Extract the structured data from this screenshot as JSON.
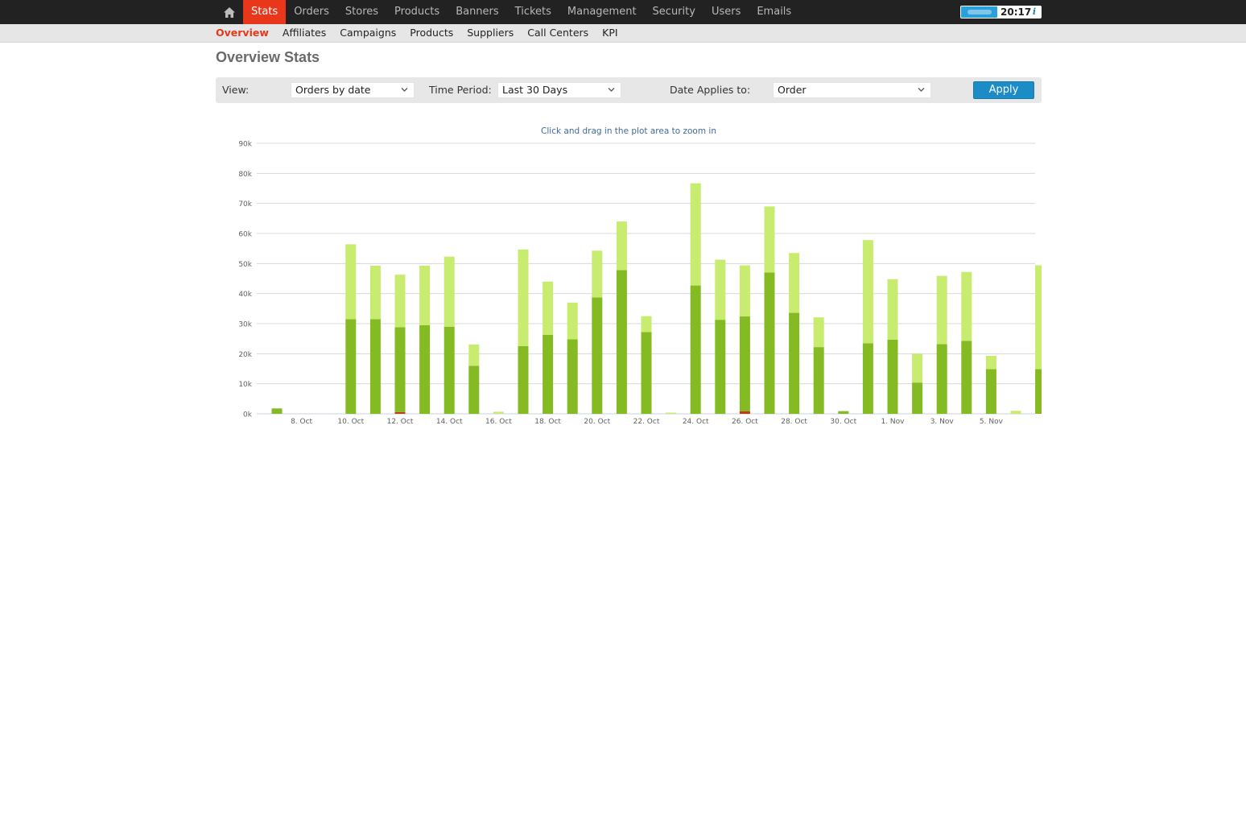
{
  "topnav": {
    "home_icon": "home-icon",
    "items": [
      {
        "label": "Stats",
        "active": true
      },
      {
        "label": "Orders"
      },
      {
        "label": "Stores"
      },
      {
        "label": "Products"
      },
      {
        "label": "Banners"
      },
      {
        "label": "Tickets"
      },
      {
        "label": "Management"
      },
      {
        "label": "Security"
      },
      {
        "label": "Users"
      },
      {
        "label": "Emails"
      }
    ],
    "clock": "20:17",
    "info_icon": "i"
  },
  "subnav": {
    "items": [
      {
        "label": "Overview",
        "active": true
      },
      {
        "label": "Affiliates"
      },
      {
        "label": "Campaigns"
      },
      {
        "label": "Products"
      },
      {
        "label": "Suppliers"
      },
      {
        "label": "Call Centers"
      },
      {
        "label": "KPI"
      }
    ]
  },
  "page": {
    "title": "Overview Stats"
  },
  "filters": {
    "view_label": "View:",
    "view_value": "Orders by date",
    "period_label": "Time Period:",
    "period_value": "Last 30 Days",
    "applies_label": "Date Applies to:",
    "applies_value": "Order",
    "apply_label": "Apply"
  },
  "colors": {
    "accent": "#e8371b",
    "nav_bg": "#222222",
    "button": "#1b8cc6",
    "bar_dark": "#84bb22",
    "bar_light": "#c8ec70",
    "bar_red": "#c0391b"
  },
  "chart_data": {
    "type": "bar",
    "stacked": true,
    "subtitle": "Click and drag in the plot area to zoom in",
    "ylim": [
      0,
      90000
    ],
    "y_ticks": [
      {
        "value": 0,
        "label": "0k"
      },
      {
        "value": 10000,
        "label": "10k"
      },
      {
        "value": 20000,
        "label": "20k"
      },
      {
        "value": 30000,
        "label": "30k"
      },
      {
        "value": 40000,
        "label": "40k"
      },
      {
        "value": 50000,
        "label": "50k"
      },
      {
        "value": 60000,
        "label": "60k"
      },
      {
        "value": 70000,
        "label": "70k"
      },
      {
        "value": 80000,
        "label": "80k"
      },
      {
        "value": 90000,
        "label": "90k"
      }
    ],
    "x_ticks": [
      "8. Oct",
      "10. Oct",
      "12. Oct",
      "14. Oct",
      "16. Oct",
      "18. Oct",
      "20. Oct",
      "22. Oct",
      "24. Oct",
      "26. Oct",
      "28. Oct",
      "30. Oct",
      "1. Nov",
      "3. Nov",
      "5. Nov"
    ],
    "grid": true,
    "legend": "none",
    "series": [
      {
        "color": "#c0391b",
        "values": [
          0,
          0,
          0,
          0,
          0,
          600,
          0,
          0,
          0,
          0,
          0,
          0,
          0,
          0,
          0,
          0,
          0,
          0,
          0,
          800,
          0,
          0,
          0,
          0,
          0,
          0,
          0,
          0,
          0,
          0,
          0,
          0
        ]
      },
      {
        "color": "#84bb22",
        "values": [
          1800,
          0,
          0,
          31500,
          31500,
          28200,
          29500,
          29000,
          16000,
          0,
          22500,
          26300,
          24800,
          38700,
          47800,
          27200,
          0,
          42700,
          31300,
          31600,
          47000,
          33600,
          22200,
          900,
          23500,
          24700,
          10400,
          23200,
          24300,
          14900,
          0,
          14900
        ]
      },
      {
        "color": "#c8ec70",
        "values": [
          0,
          0,
          0,
          24900,
          17800,
          17500,
          19800,
          23300,
          7100,
          700,
          32200,
          17700,
          12200,
          15600,
          16200,
          5300,
          400,
          34000,
          20000,
          17000,
          22000,
          19900,
          9900,
          0,
          34300,
          20100,
          9600,
          22700,
          22900,
          4400,
          1000,
          34500
        ]
      }
    ]
  }
}
